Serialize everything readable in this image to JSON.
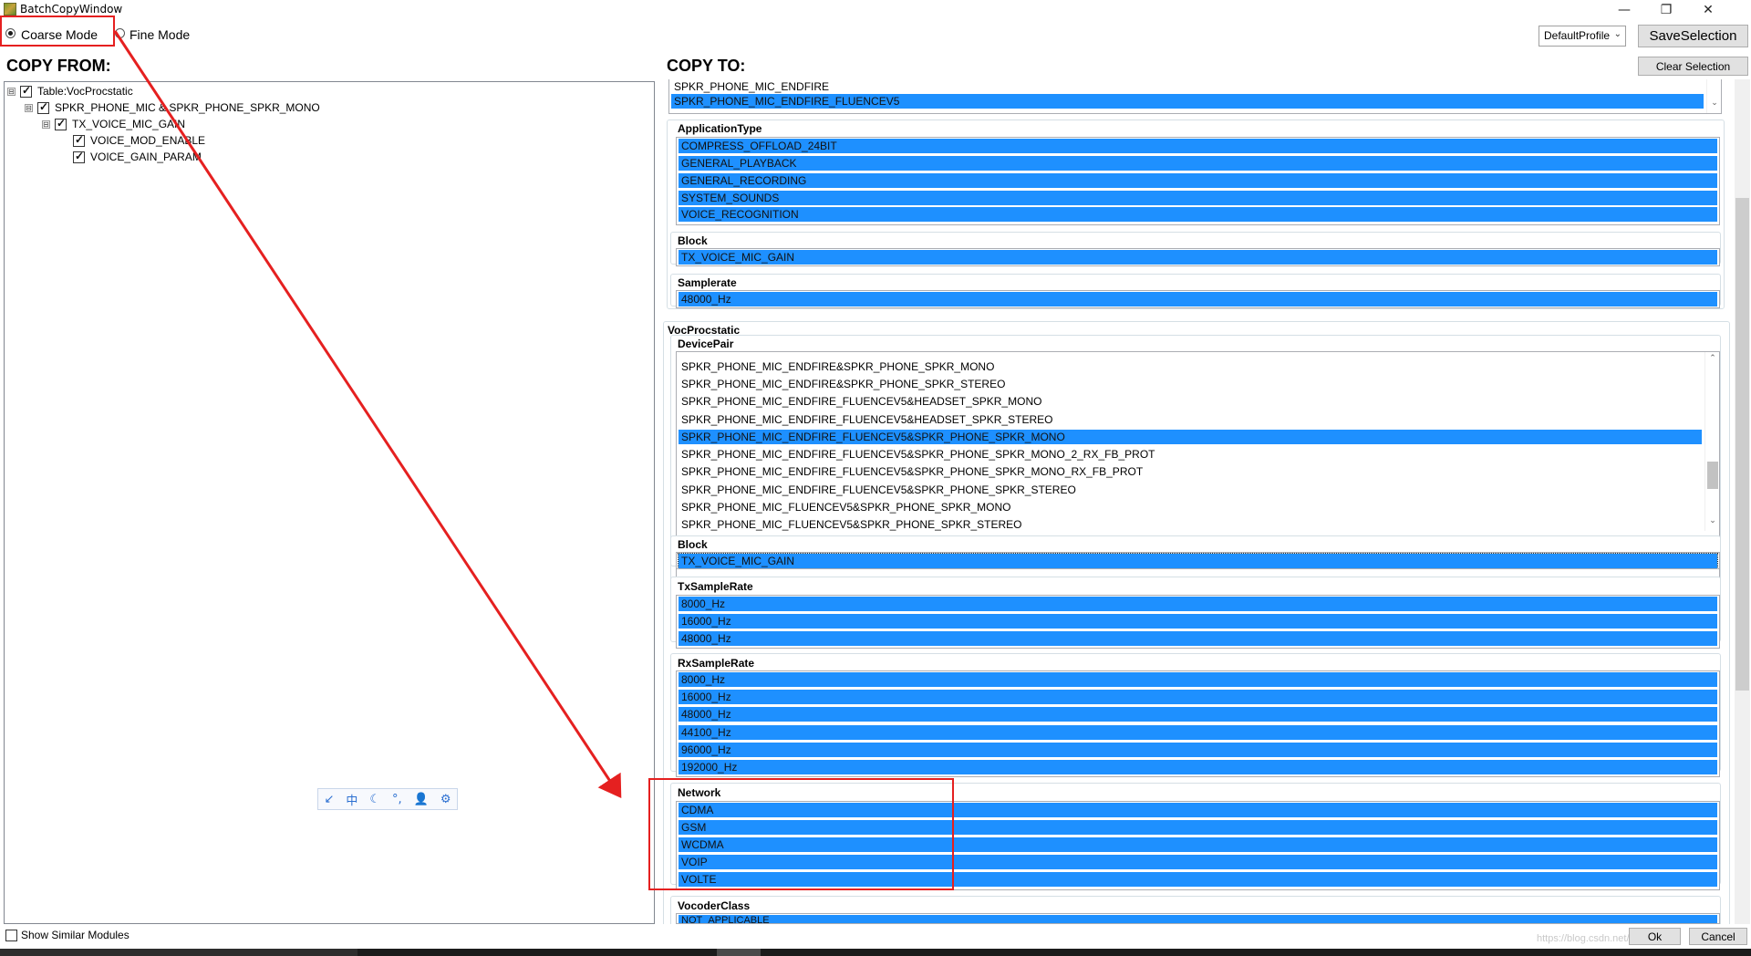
{
  "window": {
    "title": "BatchCopyWindow",
    "controls": {
      "minimize": "—",
      "restore": "❐",
      "close": "✕"
    }
  },
  "modes": {
    "coarse_label": "Coarse Mode",
    "fine_label": "Fine Mode",
    "selected": "coarse"
  },
  "toolbar": {
    "profile_value": "DefaultProfile",
    "save_label": "SaveSelection",
    "clear_label": "Clear Selection"
  },
  "copy_from": {
    "heading": "COPY FROM:",
    "tree": [
      {
        "label": "Table:VocProcstatic",
        "expander": "⊟",
        "checked": true
      },
      {
        "label": "SPKR_PHONE_MIC & SPKR_PHONE_SPKR_MONO",
        "expander": "⊟",
        "checked": true
      },
      {
        "label": "TX_VOICE_MIC_GAIN",
        "expander": "⊟",
        "checked": true
      },
      {
        "label": "VOICE_MOD_ENABLE",
        "checked": true
      },
      {
        "label": "VOICE_GAIN_PARAM",
        "checked": true
      }
    ]
  },
  "ime": {
    "icons": [
      "↙",
      "中",
      "☾",
      "°,",
      "👤",
      "⚙"
    ]
  },
  "copy_to": {
    "heading": "COPY TO:",
    "top_list": {
      "items": [
        {
          "label": "SPKR_PHONE_MIC_ENDFIRE",
          "selected": false
        },
        {
          "label": "SPKR_PHONE_MIC_ENDFIRE_FLUENCEV5",
          "selected": true
        }
      ]
    },
    "application_type": {
      "label": "ApplicationType",
      "items": [
        "COMPRESS_OFFLOAD_24BIT",
        "GENERAL_PLAYBACK",
        "GENERAL_RECORDING",
        "SYSTEM_SOUNDS",
        "VOICE_RECOGNITION"
      ]
    },
    "block_top": {
      "label": "Block",
      "items": [
        "TX_VOICE_MIC_GAIN"
      ]
    },
    "samplerate": {
      "label": "Samplerate",
      "items": [
        "48000_Hz"
      ]
    },
    "vocprocstatic": {
      "label": "VocProcstatic",
      "device_pair": {
        "label": "DevicePair",
        "items": [
          {
            "label": "SPKR_PHONE_MIC_ENDFIRE&SPKR_PHONE_SPKR_MONO",
            "selected": false
          },
          {
            "label": "SPKR_PHONE_MIC_ENDFIRE&SPKR_PHONE_SPKR_STEREO",
            "selected": false
          },
          {
            "label": "SPKR_PHONE_MIC_ENDFIRE_FLUENCEV5&HEADSET_SPKR_MONO",
            "selected": false
          },
          {
            "label": "SPKR_PHONE_MIC_ENDFIRE_FLUENCEV5&HEADSET_SPKR_STEREO",
            "selected": false
          },
          {
            "label": "SPKR_PHONE_MIC_ENDFIRE_FLUENCEV5&SPKR_PHONE_SPKR_MONO",
            "selected": true
          },
          {
            "label": "SPKR_PHONE_MIC_ENDFIRE_FLUENCEV5&SPKR_PHONE_SPKR_MONO_2_RX_FB_PROT",
            "selected": false
          },
          {
            "label": "SPKR_PHONE_MIC_ENDFIRE_FLUENCEV5&SPKR_PHONE_SPKR_MONO_RX_FB_PROT",
            "selected": false
          },
          {
            "label": "SPKR_PHONE_MIC_ENDFIRE_FLUENCEV5&SPKR_PHONE_SPKR_STEREO",
            "selected": false
          },
          {
            "label": "SPKR_PHONE_MIC_FLUENCEV5&SPKR_PHONE_SPKR_MONO",
            "selected": false
          },
          {
            "label": "SPKR_PHONE_MIC_FLUENCEV5&SPKR_PHONE_SPKR_STEREO",
            "selected": false
          }
        ]
      },
      "block": {
        "label": "Block",
        "items": [
          "TX_VOICE_MIC_GAIN"
        ]
      },
      "tx_sample_rate": {
        "label": "TxSampleRate",
        "items": [
          "8000_Hz",
          "16000_Hz",
          "48000_Hz"
        ]
      },
      "rx_sample_rate": {
        "label": "RxSampleRate",
        "items": [
          "8000_Hz",
          "16000_Hz",
          "48000_Hz",
          "44100_Hz",
          "96000_Hz",
          "192000_Hz"
        ]
      },
      "network": {
        "label": "Network",
        "items": [
          "CDMA",
          "GSM",
          "WCDMA",
          "VOIP",
          "VOLTE"
        ]
      },
      "vocoder_class": {
        "label": "VocoderClass",
        "items": [
          "NOT_APPLICABLE"
        ]
      }
    }
  },
  "footer": {
    "show_similar_label": "Show Similar Modules",
    "ok_label": "Ok",
    "cancel_label": "Cancel",
    "watermark": "https://blog.csdn.net/..."
  },
  "colors": {
    "selection": "#1e90ff",
    "annotation": "#e52020"
  }
}
